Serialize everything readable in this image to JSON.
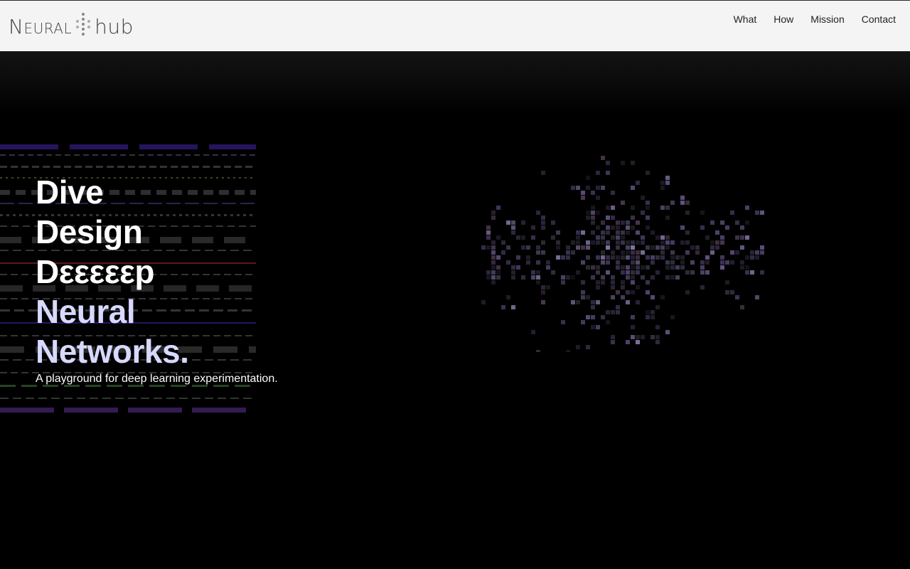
{
  "header": {
    "logo": {
      "left": "Neural",
      "right": "hub"
    },
    "nav": [
      "What",
      "How",
      "Mission",
      "Contact"
    ]
  },
  "hero": {
    "lines": [
      "Dive",
      "Design",
      "Dεεεεεp",
      "Neural",
      "Networks."
    ],
    "subtitle": "A playground for deep learning experimentation."
  },
  "colors": {
    "header_bg": "#f4f4f4",
    "hero_bg": "#000000",
    "headline_white": "#ffffff",
    "headline_accent": "#d7d9ff",
    "stripe_purple": "#2a1668",
    "stripe_red": "#6a1a1a",
    "stripe_gray": "#3a3a3a"
  },
  "icons": {
    "logo_mark": "neuron-dots-icon"
  }
}
